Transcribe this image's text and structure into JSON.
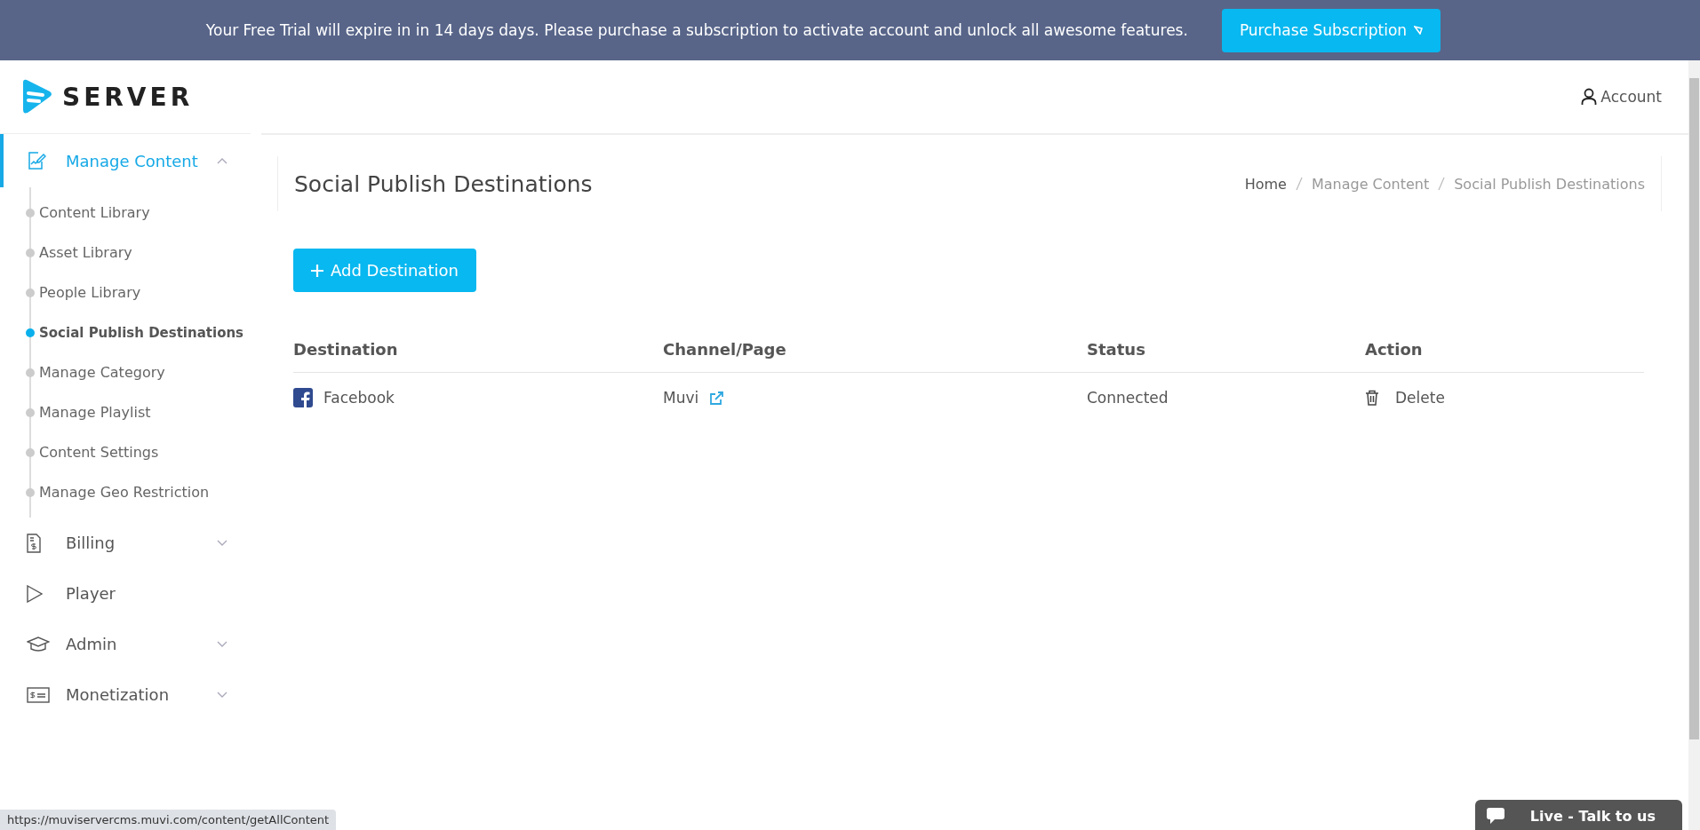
{
  "banner": {
    "message": "Your Free Trial will expire in in 14 days days. Please purchase a subscription to activate account and unlock all awesome features.",
    "button": "Purchase Subscription"
  },
  "logo": {
    "text": "SERVER"
  },
  "header": {
    "account": "Account"
  },
  "sidebar": {
    "items": [
      {
        "label": "Manage Content",
        "selected": true,
        "expanded": true,
        "children": [
          {
            "label": "Content Library",
            "selected": false
          },
          {
            "label": "Asset Library",
            "selected": false
          },
          {
            "label": "People Library",
            "selected": false
          },
          {
            "label": "Social Publish Destinations",
            "selected": true
          },
          {
            "label": "Manage Category",
            "selected": false
          },
          {
            "label": "Manage Playlist",
            "selected": false
          },
          {
            "label": "Content Settings",
            "selected": false
          },
          {
            "label": "Manage Geo Restriction",
            "selected": false
          }
        ]
      },
      {
        "label": "Billing",
        "selected": false,
        "expanded": false
      },
      {
        "label": "Player",
        "selected": false
      },
      {
        "label": "Admin",
        "selected": false,
        "expanded": false
      },
      {
        "label": "Monetization",
        "selected": false,
        "expanded": false
      }
    ]
  },
  "page": {
    "title": "Social Publish Destinations",
    "breadcrumb": [
      "Home",
      "Manage Content",
      "Social Publish Destinations"
    ],
    "add_button": "Add Destination"
  },
  "table": {
    "columns": [
      "Destination",
      "Channel/Page",
      "Status",
      "Action"
    ],
    "rows": [
      {
        "destination": "Facebook",
        "channel": "Muvi",
        "status": "Connected",
        "action": "Delete"
      }
    ]
  },
  "status_bar": {
    "url": "https://muviservercms.muvi.com/content/getAllContent"
  },
  "chat": {
    "label": "Live - Talk to us"
  }
}
